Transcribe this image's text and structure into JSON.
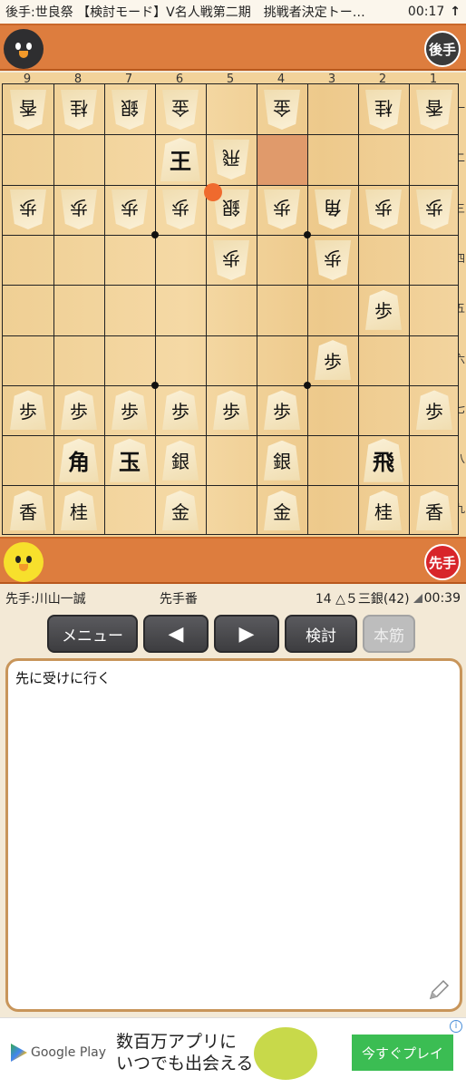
{
  "status_bar": {
    "title": "後手:世良祭 【検討モード】V名人戦第二期　挑戦者決定トー…",
    "clock": "00:17",
    "arrow": "↑"
  },
  "gote_bar": {
    "badge": "後手"
  },
  "sente_bar": {
    "badge": "先手"
  },
  "board": {
    "file_labels": [
      "9",
      "8",
      "7",
      "6",
      "5",
      "4",
      "3",
      "2",
      "1"
    ],
    "rank_labels": [
      "一",
      "二",
      "三",
      "四",
      "五",
      "六",
      "七",
      "八",
      "九"
    ],
    "last_move_square": "4二",
    "move_marker_square": "5三",
    "pieces": [
      {
        "square": "9一",
        "char": "香",
        "side": "gote"
      },
      {
        "square": "8一",
        "char": "桂",
        "side": "gote"
      },
      {
        "square": "7一",
        "char": "銀",
        "side": "gote"
      },
      {
        "square": "6一",
        "char": "金",
        "side": "gote"
      },
      {
        "square": "4一",
        "char": "金",
        "side": "gote"
      },
      {
        "square": "2一",
        "char": "桂",
        "side": "gote"
      },
      {
        "square": "1一",
        "char": "香",
        "side": "gote"
      },
      {
        "square": "6二",
        "char": "王",
        "side": "sente_big"
      },
      {
        "square": "5二",
        "char": "飛",
        "side": "gote"
      },
      {
        "square": "9三",
        "char": "歩",
        "side": "gote"
      },
      {
        "square": "8三",
        "char": "歩",
        "side": "gote"
      },
      {
        "square": "7三",
        "char": "歩",
        "side": "gote"
      },
      {
        "square": "6三",
        "char": "歩",
        "side": "gote"
      },
      {
        "square": "5三",
        "char": "銀",
        "side": "gote"
      },
      {
        "square": "4三",
        "char": "歩",
        "side": "gote"
      },
      {
        "square": "3三",
        "char": "角",
        "side": "gote"
      },
      {
        "square": "2三",
        "char": "歩",
        "side": "gote"
      },
      {
        "square": "1三",
        "char": "歩",
        "side": "gote"
      },
      {
        "square": "5四",
        "char": "歩",
        "side": "gote"
      },
      {
        "square": "3四",
        "char": "歩",
        "side": "gote"
      },
      {
        "square": "2五",
        "char": "歩",
        "side": "sente"
      },
      {
        "square": "3六",
        "char": "歩",
        "side": "sente"
      },
      {
        "square": "9七",
        "char": "歩",
        "side": "sente"
      },
      {
        "square": "8七",
        "char": "歩",
        "side": "sente"
      },
      {
        "square": "7七",
        "char": "歩",
        "side": "sente"
      },
      {
        "square": "6七",
        "char": "歩",
        "side": "sente"
      },
      {
        "square": "5七",
        "char": "歩",
        "side": "sente"
      },
      {
        "square": "4七",
        "char": "歩",
        "side": "sente"
      },
      {
        "square": "1七",
        "char": "歩",
        "side": "sente"
      },
      {
        "square": "8八",
        "char": "角",
        "side": "sente_big"
      },
      {
        "square": "7八",
        "char": "玉",
        "side": "sente_big"
      },
      {
        "square": "6八",
        "char": "銀",
        "side": "sente"
      },
      {
        "square": "4八",
        "char": "銀",
        "side": "sente"
      },
      {
        "square": "2八",
        "char": "飛",
        "side": "sente_big"
      },
      {
        "square": "9九",
        "char": "香",
        "side": "sente"
      },
      {
        "square": "8九",
        "char": "桂",
        "side": "sente"
      },
      {
        "square": "6九",
        "char": "金",
        "side": "sente"
      },
      {
        "square": "4九",
        "char": "金",
        "side": "sente"
      },
      {
        "square": "2九",
        "char": "桂",
        "side": "sente"
      },
      {
        "square": "1九",
        "char": "香",
        "side": "sente"
      }
    ]
  },
  "info_row": {
    "player": "先手:川山一誠",
    "turn": "先手番",
    "move": "14 △５三銀(42)",
    "time": "00:39"
  },
  "toolbar": {
    "menu": "メニュー",
    "prev": "◀",
    "next": "▶",
    "kentou": "検討",
    "honsuji": "本筋"
  },
  "comment": {
    "text": "先に受けに行く"
  },
  "ad": {
    "brand": "Google Play",
    "promo_line1": "数百万アプリに",
    "promo_line2": "いつでも出会える",
    "cta": "今すぐプレイ",
    "info": "i"
  }
}
